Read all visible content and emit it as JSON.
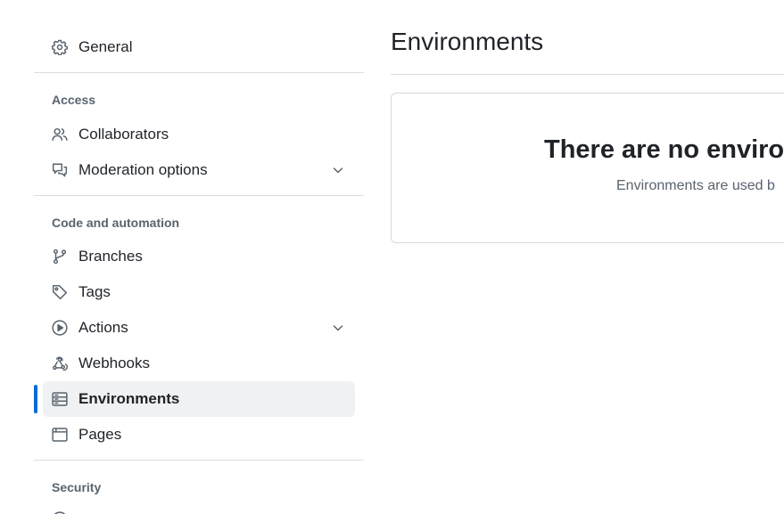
{
  "sidebar": {
    "general": {
      "label": "General",
      "icon": "gear-icon"
    },
    "groups": [
      {
        "heading": "Access",
        "items": [
          {
            "label": "Collaborators",
            "icon": "people-icon"
          },
          {
            "label": "Moderation options",
            "icon": "comment-discussion-icon",
            "expandable": true
          }
        ]
      },
      {
        "heading": "Code and automation",
        "items": [
          {
            "label": "Branches",
            "icon": "git-branch-icon"
          },
          {
            "label": "Tags",
            "icon": "tag-icon"
          },
          {
            "label": "Actions",
            "icon": "play-icon",
            "expandable": true
          },
          {
            "label": "Webhooks",
            "icon": "webhook-icon"
          },
          {
            "label": "Environments",
            "icon": "server-icon",
            "selected": true
          },
          {
            "label": "Pages",
            "icon": "browser-icon"
          }
        ]
      },
      {
        "heading": "Security",
        "items": []
      }
    ]
  },
  "main": {
    "title": "Environments",
    "empty_state": {
      "title": "There are no environr",
      "description": "Environments are used b"
    }
  },
  "colors": {
    "accent": "#0969da",
    "selected_bg": "#eff1f3",
    "muted_text": "#59636e",
    "border": "#d8dee4"
  }
}
